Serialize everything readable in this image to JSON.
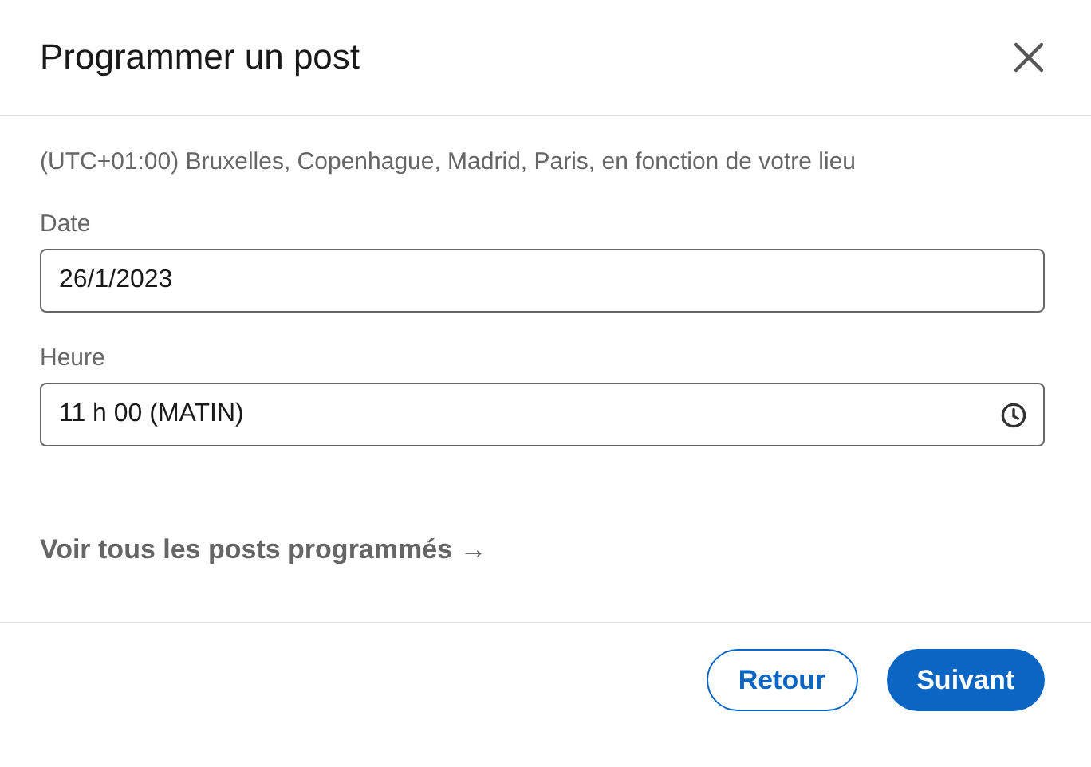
{
  "dialog": {
    "title": "Programmer un post"
  },
  "timezone": "(UTC+01:00) Bruxelles, Copenhague, Madrid, Paris, en fonction de votre lieu",
  "fields": [
    {
      "kind": "date",
      "label": "Date",
      "value": "26/1/2023"
    },
    {
      "kind": "time",
      "label": "Heure",
      "value": "11 h 00 (MATIN)"
    }
  ],
  "link": "Voir tous les posts programmés →",
  "buttons": [
    {
      "kind": "secondary",
      "label": "Retour"
    },
    {
      "kind": "primary",
      "label": "Suivant"
    }
  ]
}
